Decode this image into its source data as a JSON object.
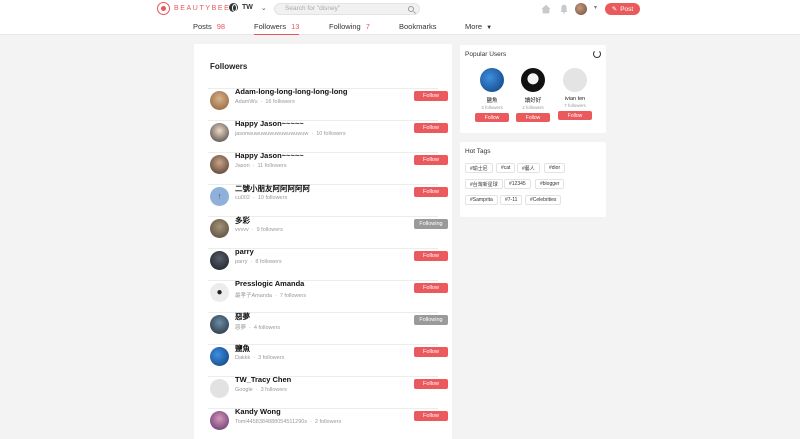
{
  "brand": {
    "logo_text": "BEAUTYBEE",
    "accent": "#ea5a5c"
  },
  "header": {
    "region": "TW",
    "search_placeholder": "Search for \"disney\"",
    "post_label": "Post"
  },
  "tabs": [
    {
      "label": "Posts",
      "count": "98"
    },
    {
      "label": "Followers",
      "count": "13"
    },
    {
      "label": "Following",
      "count": "7"
    },
    {
      "label": "Bookmarks"
    },
    {
      "label": "More",
      "caret": "▼"
    }
  ],
  "active_tab": "Followers",
  "main": {
    "title": "Followers",
    "items": [
      {
        "name": "Adam-long-long-long-long-long",
        "handle": "AdamWu",
        "followers": "16 followers",
        "button": "Follow"
      },
      {
        "name": "Happy Jason~~~~~",
        "handle": "jasonwuwuwuwuwuwuwuwuw",
        "followers": "10 followers",
        "button": "Follow"
      },
      {
        "name": "Happy Jason~~~~~",
        "handle": "Jason",
        "followers": "11 followers",
        "button": "Follow"
      },
      {
        "name": "二號小朋友阿阿阿阿阿",
        "handle": "cu002",
        "followers": "10 followers",
        "button": "Follow"
      },
      {
        "name": "多彩",
        "handle": "vvvvv",
        "followers": "9 followers",
        "button": "Following"
      },
      {
        "name": "parry",
        "handle": "parry",
        "followers": "8 followers",
        "button": "Follow"
      },
      {
        "name": "Presslogic Amanda",
        "handle": "最孝子Amanda",
        "followers": "7 followers",
        "button": "Follow"
      },
      {
        "name": "惡夢",
        "handle": "惡夢",
        "followers": "4 followers",
        "button": "Following"
      },
      {
        "name": "鹽魚",
        "handle": "Dakkk",
        "followers": "3 followers",
        "button": "Follow"
      },
      {
        "name": "TW_Tracy Chen",
        "handle": "Google",
        "followers": "3 followers",
        "button": "Follow"
      },
      {
        "name": "Kandy Wong",
        "handle": "Tomi4458384888054511290s",
        "followers": "2 followers",
        "button": "Follow"
      }
    ]
  },
  "popular_users": {
    "title": "Popular Users",
    "users": [
      {
        "name": "鹽魚",
        "followers": "3 followers",
        "button": "Follow"
      },
      {
        "name": "讀好好",
        "followers": "2 followers",
        "button": "Follow"
      },
      {
        "name": "ivian ten",
        "followers": "7 followers",
        "button": "Follow"
      }
    ]
  },
  "hot_tags": {
    "title": "Hot Tags",
    "tags": [
      "#瑜士尼",
      "#cat",
      "#藝人",
      "#dior",
      "#台灣新星球",
      "#12345",
      "#blogger",
      "#Samprita",
      "#7-11",
      "#Celebrities"
    ]
  }
}
